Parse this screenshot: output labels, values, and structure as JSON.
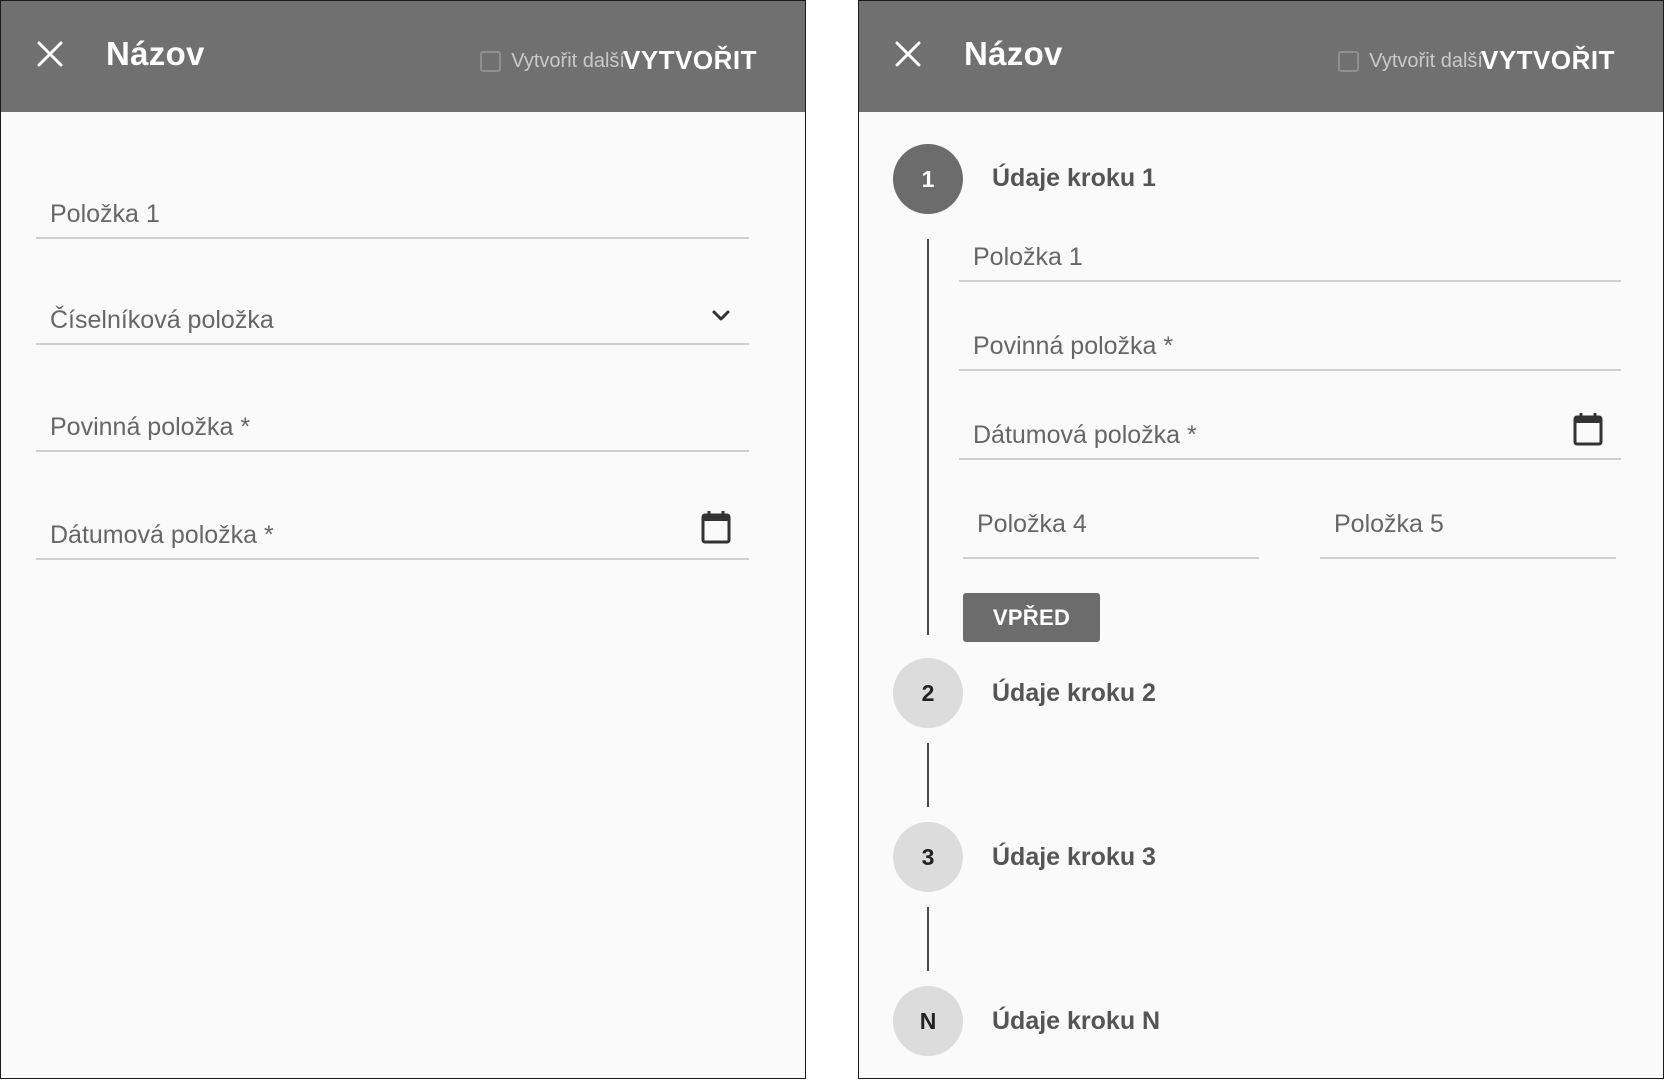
{
  "left_panel": {
    "header": {
      "title": "Názov",
      "create_more_label": "Vytvořit další",
      "create_more_checked": false,
      "create_button": "VYTVOŘIT"
    },
    "fields": [
      {
        "label": "Položka 1",
        "type": "text"
      },
      {
        "label": "Číselníková položka",
        "type": "select",
        "icon": "chevron-down-icon"
      },
      {
        "label": "Povinná položka *",
        "type": "text"
      },
      {
        "label": "Dátumová položka *",
        "type": "date",
        "icon": "calendar-icon"
      }
    ]
  },
  "right_panel": {
    "header": {
      "title": "Názov",
      "create_more_label": "Vytvořit další",
      "create_more_checked": false,
      "create_button": "VYTVOŘIT"
    },
    "steps": [
      {
        "number": "1",
        "title": "Údaje kroku 1",
        "active": true
      },
      {
        "number": "2",
        "title": "Údaje kroku 2",
        "active": false
      },
      {
        "number": "3",
        "title": "Údaje kroku 3",
        "active": false
      },
      {
        "number": "N",
        "title": "Údaje kroku N",
        "active": false
      }
    ],
    "step1_fields": [
      {
        "label": "Položka 1",
        "type": "text"
      },
      {
        "label": "Povinná položka *",
        "type": "text"
      },
      {
        "label": "Dátumová položka *",
        "type": "date",
        "icon": "calendar-icon"
      },
      {
        "label": "Položka 4",
        "type": "text"
      },
      {
        "label": "Položka 5",
        "type": "text"
      }
    ],
    "next_button": "VPŘED"
  },
  "colors": {
    "appbar": "#707070",
    "background": "#fafafa",
    "active_step": "#6c6c6c",
    "inactive_step": "#dcdcdc",
    "underline": "#cfcfcf"
  }
}
